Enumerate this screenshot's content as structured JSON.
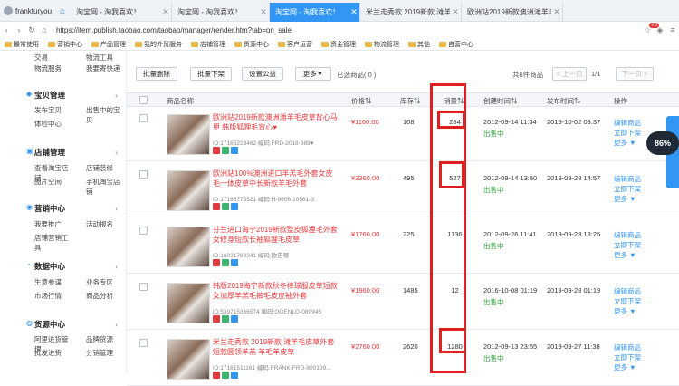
{
  "browser": {
    "user": "frankfuryou",
    "tabs": [
      {
        "label": "淘宝网 - 淘我喜欢！",
        "active": false
      },
      {
        "label": "淘宝网 - 淘我喜欢！",
        "active": false
      },
      {
        "label": "淘宝网 - 淘我喜欢！",
        "active": true
      },
      {
        "label": "米兰走秀款 2019新款 滩羊毛皮",
        "active": false
      },
      {
        "label": "欧洲站2019新款澳洲滩羊毛皮",
        "active": false
      }
    ],
    "url": "https://item.publish.taobao.com/taobao/manager/render.htm?tab=on_sale",
    "badge": "78",
    "bookmarks": [
      "最常使用",
      "营销中心",
      "产品管理",
      "我的外贸服务",
      "店铺管理",
      "货源中心",
      "客户运营",
      "资金管理",
      "物流管理",
      "其他",
      "自营中心"
    ]
  },
  "sidebar": {
    "top_rows": [
      [
        "交易",
        "物流工具"
      ],
      [
        "物流服务",
        "我要寄快递"
      ]
    ],
    "sections": [
      {
        "icon": "box-icon",
        "title": "宝贝管理",
        "rows": [
          [
            "发布宝贝",
            "出售中的宝贝"
          ],
          [
            "体检中心",
            ""
          ]
        ]
      },
      {
        "icon": "store-icon",
        "title": "店铺管理",
        "rows": [
          [
            "查看淘宝店铺",
            "店铺装修"
          ],
          [
            "图片空间",
            "手机淘宝店铺"
          ]
        ]
      },
      {
        "icon": "megaphone-icon",
        "title": "营销中心",
        "rows": [
          [
            "我要推广",
            "活动报名"
          ],
          [
            "店铺营销工具",
            ""
          ]
        ]
      },
      {
        "icon": "chart-icon",
        "title": "数据中心",
        "rows": [
          [
            "生意参谋",
            "业务专区"
          ],
          [
            "市场行情",
            "商品分析"
          ]
        ]
      },
      {
        "icon": "source-icon",
        "title": "货源中心",
        "rows": [
          [
            "阿里进货管理",
            "品牌货源"
          ],
          [
            "批发进货",
            "分销管理"
          ]
        ]
      }
    ]
  },
  "toolbar": {
    "batch_delete": "批量删除",
    "batch_down": "批量下架",
    "set_discount": "设置公益",
    "more": "更多▼",
    "selected": "已选商品( 0 )",
    "total": "共6件商品",
    "prev": "< 上一页",
    "page": "1/1",
    "next": "下一页 >"
  },
  "table": {
    "headers": {
      "name": "商品名称",
      "price": "价格⇅",
      "stock": "库存⇅",
      "sales": "销量⇅",
      "created": "创建时间⇅",
      "published": "发布时间⇅",
      "actions": "操作"
    },
    "rows": [
      {
        "title": "欧洲站2019新款澳洲滩羊毛皮草背心马甲 韩版狐狸毛背心♥",
        "meta": "ID:17165223462 编码:FRD-2018-989♥",
        "price": "¥1160.00",
        "stock": "108",
        "sales": "284",
        "created": "2012-09-14 11:34",
        "status": "出售中",
        "published": "2019-10-02 09:37",
        "a1": "编辑商品",
        "a2": "立即下架",
        "a3": "更多 ▼"
      },
      {
        "title": "欧洲站100%澳洲进口羊羔毛外套女皮毛一体皮草中长新款羊毛外套",
        "meta": "ID:17166775521 编码:H-9806-10581-3",
        "price": "¥3360.00",
        "stock": "495",
        "sales": "527",
        "created": "2012-09-14 13:50",
        "status": "出售中",
        "published": "2019-09-28 14:57",
        "a1": "编辑商品",
        "a2": "立即下架",
        "a3": "更多 ▼"
      },
      {
        "title": "芬兰进口海宁2019新款整皮狐狸毛外套女修身短款长袖狐狸毛皮草",
        "meta": "ID:16021769341 编码:欧告哪",
        "price": "¥1760.00",
        "stock": "225",
        "sales": "1136",
        "created": "2012-09-26 11:41",
        "status": "出售中",
        "published": "2019-09-28 13:25",
        "a1": "编辑商品",
        "a2": "立即下架",
        "a3": "更多 ▼"
      },
      {
        "title": "韩版2019海宁新款秋冬棒球服皮草短款女加厚羊羔毛裤毛皮皮袖外套",
        "meta": "ID:539715366574 编码:OGENLO-080945",
        "price": "¥1960.00",
        "stock": "1485",
        "sales": "12",
        "created": "2016-10-08 01:19",
        "status": "出售中",
        "published": "2019-09-28 01:19",
        "a1": "编辑商品",
        "a2": "立即下架",
        "a3": "更多 ▼"
      },
      {
        "title": "米兰走秀款 2019新款 滩羊毛皮草外套短款圆领羊羔 羊毛羊皮草",
        "meta": "ID:17161511161 编码:FRANK-FRD-800109...",
        "price": "¥2760.00",
        "stock": "2620",
        "sales": "1280",
        "created": "2012-09-13 23:55",
        "status": "出售中",
        "published": "2019-09-27 11:38",
        "a1": "编辑商品",
        "a2": "立即下架",
        "a3": "更多 ▼"
      }
    ]
  },
  "float_widget": "86%"
}
